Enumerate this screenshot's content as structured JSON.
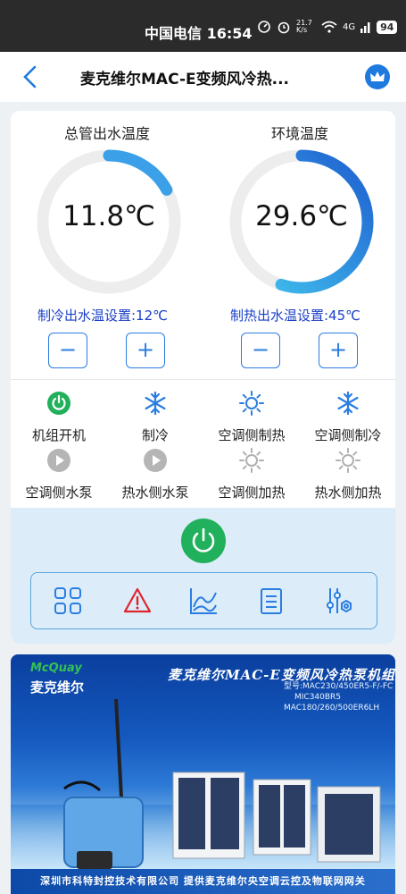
{
  "status_bar": {
    "carrier_time": "中国电信 16:54",
    "net_speed": "21.7 K/s",
    "network": "4G",
    "battery": "94"
  },
  "nav": {
    "title": "麦克维尔MAC-E变频风冷热..."
  },
  "gauges": [
    {
      "title": "总管出水温度",
      "value": "11.8℃",
      "fill": 0.17,
      "color": "#3ba0e8"
    },
    {
      "title": "环境温度",
      "value": "29.6℃",
      "fill": 0.55,
      "color": "#2a7de1"
    }
  ],
  "setpoints": {
    "cooling": "制冷出水温设置:12℃",
    "heating": "制热出水温设置:45℃",
    "minus": "−",
    "plus": "+"
  },
  "status_items": [
    {
      "label": "机组开机",
      "icon": "power-on-icon"
    },
    {
      "label": "制冷",
      "icon": "snowflake-icon"
    },
    {
      "label": "空调侧制热",
      "icon": "sun-icon"
    },
    {
      "label": "空调侧制冷",
      "icon": "snowflake-icon"
    },
    {
      "label": "空调侧水泵",
      "icon": "play-icon"
    },
    {
      "label": "热水侧水泵",
      "icon": "play-icon"
    },
    {
      "label": "空调侧加热",
      "icon": "sun-icon"
    },
    {
      "label": "热水侧加热",
      "icon": "sun-icon"
    }
  ],
  "toolbar": {
    "items": [
      "grid-icon",
      "warning-icon",
      "chart-icon",
      "list-icon",
      "settings-sliders-icon"
    ]
  },
  "colors": {
    "accent": "#2a7de1",
    "setpoint_text": "#1a3fc7",
    "power_green": "#21b05b",
    "alarm_red": "#e0242c"
  },
  "banner": {
    "logo_en": "McQuay",
    "logo_cn": "麦克维尔",
    "headline": "麦克维尔MAC-E变频风冷热泵机组",
    "models": [
      "型号:MAC230/450ER5-F/-FC",
      "MIC340BR5",
      "MAC180/260/500ER6LH"
    ],
    "footer": "深圳市科特封控技术有限公司   提供麦克维尔央空调云控及物联网网关"
  }
}
